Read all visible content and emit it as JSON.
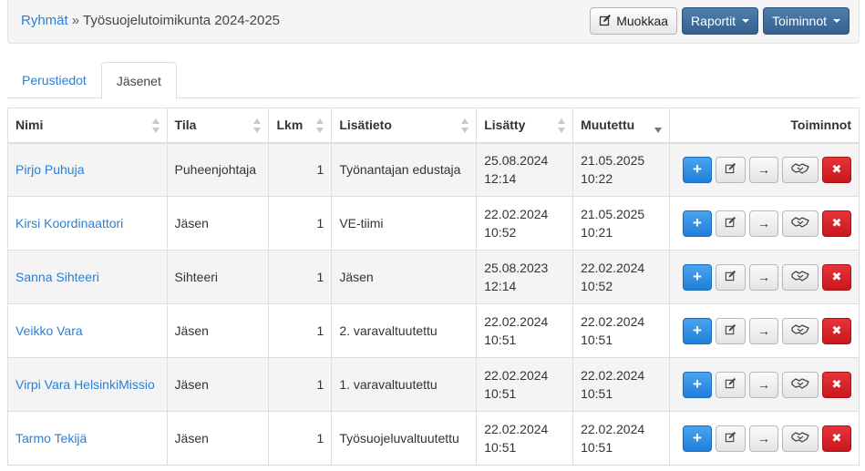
{
  "breadcrumb": {
    "parent": "Ryhmät",
    "separator": "»",
    "current": "Työsuojelutoimikunta 2024-2025"
  },
  "toolbar": {
    "edit_label": "Muokkaa",
    "reports_label": "Raportit",
    "actions_label": "Toiminnot"
  },
  "tabs": [
    {
      "label": "Perustiedot",
      "active": false
    },
    {
      "label": "Jäsenet",
      "active": true
    }
  ],
  "table": {
    "headers": {
      "name": "Nimi",
      "status": "Tila",
      "count": "Lkm",
      "info": "Lisätieto",
      "added": "Lisätty",
      "modified": "Muutettu",
      "actions": "Toiminnot"
    },
    "rows": [
      {
        "name": "Pirjo Puhuja",
        "status": "Puheenjohtaja",
        "count": "1",
        "info": "Työnantajan edustaja",
        "added_date": "25.08.2024",
        "added_time": "12:14",
        "modified_date": "21.05.2025",
        "modified_time": "10:22"
      },
      {
        "name": "Kirsi Koordinaattori",
        "status": "Jäsen",
        "count": "1",
        "info": "VE-tiimi",
        "added_date": "22.02.2024",
        "added_time": "10:52",
        "modified_date": "21.05.2025",
        "modified_time": "10:21"
      },
      {
        "name": "Sanna Sihteeri",
        "status": "Sihteeri",
        "count": "1",
        "info": "Jäsen",
        "added_date": "25.08.2023",
        "added_time": "12:14",
        "modified_date": "22.02.2024",
        "modified_time": "10:52"
      },
      {
        "name": "Veikko Vara",
        "status": "Jäsen",
        "count": "1",
        "info": "2. varavaltuutettu",
        "added_date": "22.02.2024",
        "added_time": "10:51",
        "modified_date": "22.02.2024",
        "modified_time": "10:51"
      },
      {
        "name": "Virpi Vara HelsinkiMissio",
        "status": "Jäsen",
        "count": "1",
        "info": "1. varavaltuutettu",
        "added_date": "22.02.2024",
        "added_time": "10:51",
        "modified_date": "22.02.2024",
        "modified_time": "10:51"
      },
      {
        "name": "Tarmo Tekijä",
        "status": "Jäsen",
        "count": "1",
        "info": "Työsuojeluvaltuutettu",
        "added_date": "22.02.2024",
        "added_time": "10:51",
        "modified_date": "22.02.2024",
        "modified_time": "10:51"
      }
    ],
    "row_actions": [
      {
        "icon": "plus-icon",
        "glyph": "+"
      },
      {
        "icon": "edit-icon"
      },
      {
        "icon": "arrow-right-icon",
        "glyph": "→"
      },
      {
        "icon": "handshake-icon"
      },
      {
        "icon": "close-icon",
        "glyph": "✖"
      }
    ]
  },
  "colors": {
    "link": "#2a7fd4",
    "navy_button": "#3e6a99",
    "blue_button": "#2b8ae0",
    "red_button": "#d8222a",
    "stripe": "#f4f4f4"
  }
}
